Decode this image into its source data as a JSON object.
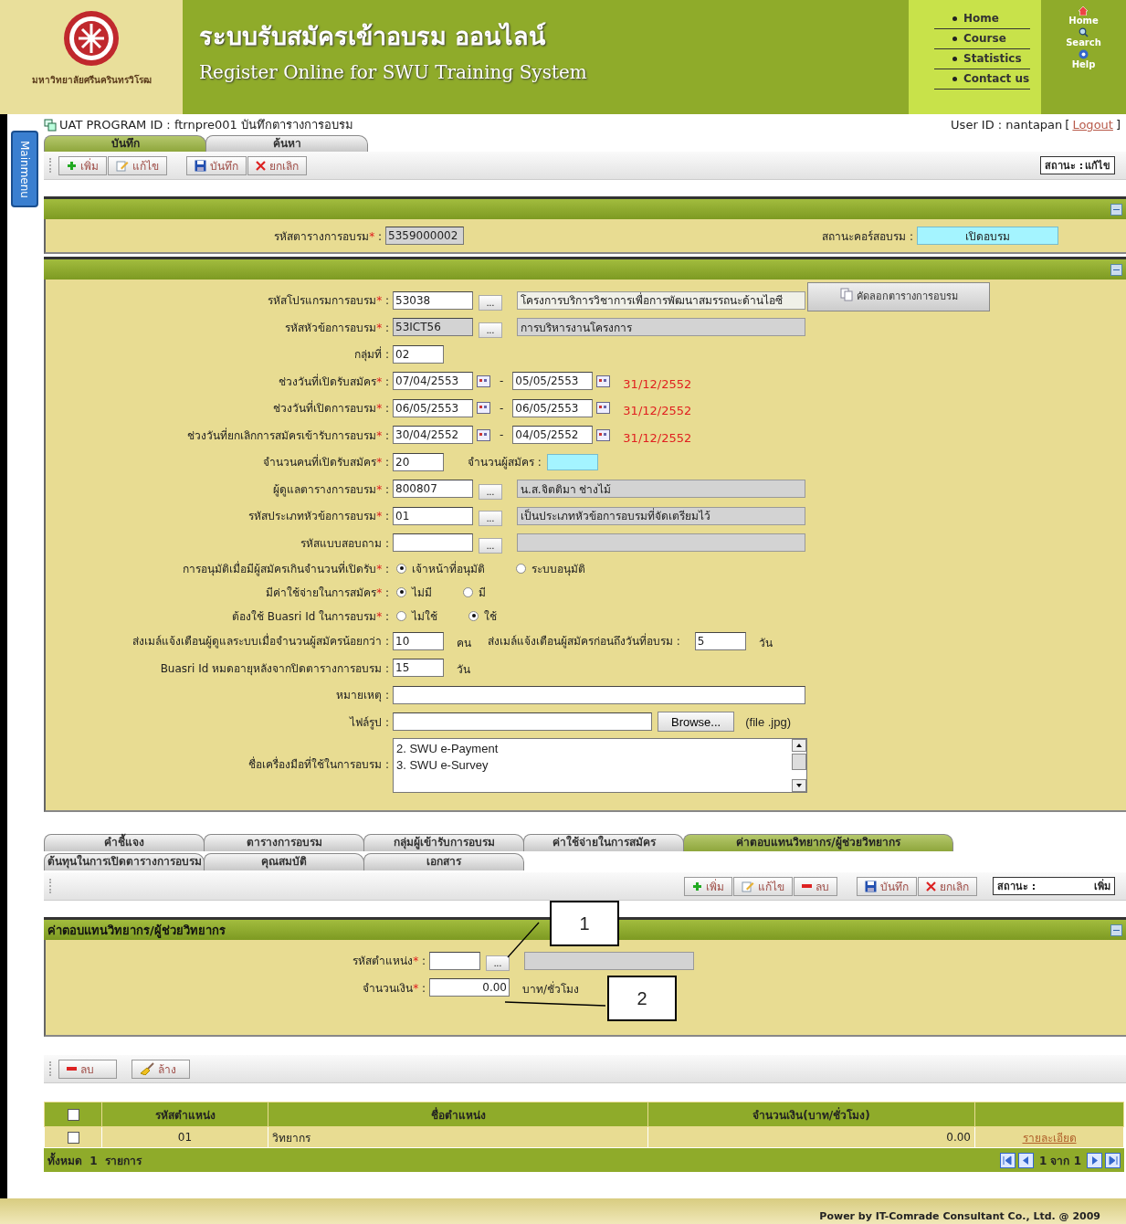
{
  "header": {
    "university": "มหาวิทยาลัยศรีนครินทรวิโรฒ",
    "title_th": "ระบบรับสมัครเข้าอบรม ออนไลน์",
    "title_en": "Register Online for  SWU Training System",
    "nav": [
      "Home",
      "Course",
      "Statistics",
      "Contact us"
    ],
    "quick_links": [
      {
        "kind": "home",
        "label": "Home"
      },
      {
        "kind": "search",
        "label": "Search"
      },
      {
        "kind": "help",
        "label": "Help"
      }
    ]
  },
  "side_tab": "Mainmenu",
  "info_bar": {
    "program": "UAT   PROGRAM ID : ftrnpre001 บันทึกตารางการอบรม",
    "user": "User ID : nantapan",
    "bracket_open": "[",
    "logout": "Logout",
    "bracket_close": "]"
  },
  "main_tabs": [
    {
      "label": "บันทึก",
      "selected": true
    },
    {
      "label": "ค้นหา",
      "selected": false
    }
  ],
  "toolbar": {
    "groups": [
      [
        {
          "kind": "add",
          "label": "เพิ่ม"
        },
        {
          "kind": "edit",
          "label": "แก้ไข"
        }
      ],
      [
        {
          "kind": "save",
          "label": "บันทึก"
        },
        {
          "kind": "cancel",
          "label": "ยกเลิก"
        }
      ]
    ],
    "status_label": "สถานะ :",
    "status_value": "แก้ไข"
  },
  "course_section": {
    "label": "รหัสตารางการอบรม",
    "req": "*",
    "sep": ":",
    "value": "5359000002",
    "status_label": "สถานะคอร์สอบรม :",
    "status_value": "เปิดอบรม"
  },
  "form": {
    "copy_button": "คัดลอกตารางการอบรม",
    "rows": [
      {
        "kind": "lookup",
        "label": "รหัสโปรแกรมการอบรม",
        "req": "*",
        "sep": ":",
        "code": "53038",
        "readonly": false,
        "button": "...",
        "description": "โครงการบริการวิชาการเพื่อการพัฒนาสมรรถนะด้านไอซี",
        "copy": true
      },
      {
        "kind": "lookup",
        "label": "รหัสหัวข้อการอบรม",
        "req": "*",
        "sep": ":",
        "code": "53ICT56",
        "readonly": true,
        "button": "...",
        "description": "การบริหารงานโครงการ",
        "copy": false
      },
      {
        "kind": "text",
        "label": "กลุ่มที่",
        "sep": ":",
        "value": "02"
      },
      {
        "kind": "daterange",
        "label": "ช่วงวันที่เปิดรับสมัคร",
        "req": "*",
        "sep": ":",
        "from": "07/04/2553",
        "dash": "-",
        "to": "05/05/2553",
        "note": "31/12/2552"
      },
      {
        "kind": "daterange",
        "label": "ช่วงวันที่เปิดการอบรม",
        "req": "*",
        "sep": ":",
        "from": "06/05/2553",
        "dash": "-",
        "to": "06/05/2553",
        "note": "31/12/2552"
      },
      {
        "kind": "daterange",
        "label": "ช่วงวันที่ยกเลิกการสมัครเข้ารับการอบรม",
        "req": "*",
        "sep": ":",
        "from": "30/04/2552",
        "dash": "-",
        "to": "04/05/2552",
        "note": "31/12/2552"
      },
      {
        "kind": "count",
        "label": "จำนวนคนที่เปิดรับสมัคร",
        "req": "*",
        "sep": ":",
        "value": "20",
        "extra_label": "จำนวนผู้สมัคร :"
      },
      {
        "kind": "lookup",
        "label": "ผู้ดูแลตารางการอบรม",
        "req": "*",
        "sep": ":",
        "code": "800807",
        "readonly": false,
        "button": "...",
        "description": "น.ส.จิตติมา  ช่างไม้",
        "copy": false
      },
      {
        "kind": "lookup",
        "label": "รหัสประเภทหัวข้อการอบรม",
        "req": "*",
        "sep": ":",
        "code": "01",
        "readonly": false,
        "button": "...",
        "description": "เป็นประเภทหัวข้อการอบรมที่จัดเตรียมไว้",
        "copy": false
      },
      {
        "kind": "lookup",
        "label": "รหัสแบบสอบถาม",
        "sep": ":",
        "readonly": false,
        "button": "...",
        "copy": false
      },
      {
        "kind": "radio",
        "label": "การอนุมัติเมื่อมีผู้สมัครเกินจำนวนที่เปิดรับ",
        "req": "*",
        "sep": ":",
        "options": [
          {
            "label": "เจ้าหน้าที่อนุมัติ",
            "selected": true
          },
          {
            "label": "ระบบอนุมัติ",
            "selected": false
          }
        ]
      },
      {
        "kind": "radio",
        "label": "มีค่าใช้จ่ายในการสมัคร",
        "req": "*",
        "sep": ":",
        "options": [
          {
            "label": "ไม่มี",
            "selected": true
          },
          {
            "label": "มี",
            "selected": false
          }
        ]
      },
      {
        "kind": "radio",
        "label": "ต้องใช้ Buasri Id ในการอบรม",
        "req": "*",
        "sep": ":",
        "options": [
          {
            "label": "ไม่ใช้",
            "selected": false
          },
          {
            "label": "ใช้",
            "selected": true
          }
        ]
      },
      {
        "kind": "pair",
        "label": "ส่งเมล์แจ้งเตือนผู้ดูแลระบบเมื่อจำนวนผู้สมัครน้อยกว่า",
        "sep": ":",
        "value": "10",
        "unit": "คน",
        "label2": "ส่งเมล์แจ้งเตือนผู้สมัครก่อนถึงวันที่อบรม :",
        "value2": "5",
        "unit2": "วัน"
      },
      {
        "kind": "unit",
        "label": "Buasri Id หมดอายุหลังจากปิดตารางการอบรม",
        "sep": ":",
        "value": "15",
        "unit": "วัน"
      },
      {
        "kind": "wide",
        "label": "หมายเหตุ",
        "sep": ":"
      },
      {
        "kind": "file",
        "label": "ไฟล์รูป",
        "sep": ":",
        "button": "Browse...",
        "hint": "(file .jpg)"
      },
      {
        "kind": "list",
        "label": "ชื่อเครื่องมือที่ใช้ในการอบรม",
        "sep": ":",
        "items": [
          "2. SWU e-Payment",
          "3. SWU e-Survey"
        ]
      }
    ]
  },
  "detail_tabs": [
    [
      {
        "label": "คำชี้แจง",
        "selected": false
      },
      {
        "label": "ตารางการอบรม",
        "selected": false
      },
      {
        "label": "กลุ่มผู้เข้ารับการอบรม",
        "selected": false
      },
      {
        "label": "ค่าใช้จ่ายในการสมัคร",
        "selected": false
      },
      {
        "label": "ค่าตอบแทนวิทยากร/ผู้ช่วยวิทยากร",
        "selected": true
      }
    ],
    [
      {
        "label": "ต้นทุนในการเปิดตารางการอบรม",
        "selected": false
      },
      {
        "label": "คุณสมบัติ",
        "selected": false
      },
      {
        "label": "เอกสาร",
        "selected": false
      }
    ]
  ],
  "toolbar2": {
    "groups": [
      [
        {
          "kind": "add",
          "label": "เพิ่ม"
        },
        {
          "kind": "edit",
          "label": "แก้ไข"
        },
        {
          "kind": "remove",
          "label": "ลบ"
        }
      ],
      [
        {
          "kind": "save",
          "label": "บันทึก"
        },
        {
          "kind": "cancel",
          "label": "ยกเลิก"
        }
      ]
    ],
    "status_label": "สถานะ :",
    "status_value": "เพิ่ม"
  },
  "fee_section": {
    "title": "ค่าตอบแทนวิทยากร/ผู้ช่วยวิทยากร",
    "position": {
      "label": "รหัสตำแหน่ง",
      "req": "*",
      "sep": ":",
      "button": "..."
    },
    "amount": {
      "label": "จำนวนเงิน",
      "req": "*",
      "sep": ":",
      "value": "0.00",
      "unit": "บาท/ชั่วโมง"
    },
    "callouts": [
      "1",
      "2"
    ]
  },
  "toolbar3": {
    "buttons": [
      {
        "kind": "remove",
        "label": "ลบ"
      },
      {
        "kind": "clear",
        "label": "ล้าง"
      }
    ]
  },
  "table": {
    "header_checked": false,
    "columns": [
      "รหัสตำแหน่ง",
      "ชื่อตำแหน่ง",
      "จำนวนเงิน(บาท/ชั่วโมง)"
    ],
    "rows": [
      {
        "checked": false,
        "code": "01",
        "name": "วิทยากร",
        "amount": "0.00",
        "link": "รายละเอียด"
      }
    ],
    "total": "ทั้งหมด  1  รายการ",
    "page": "1 จาก 1"
  },
  "footer": "Power by IT-Comrade Consultant Co., Ltd. @ 2009"
}
